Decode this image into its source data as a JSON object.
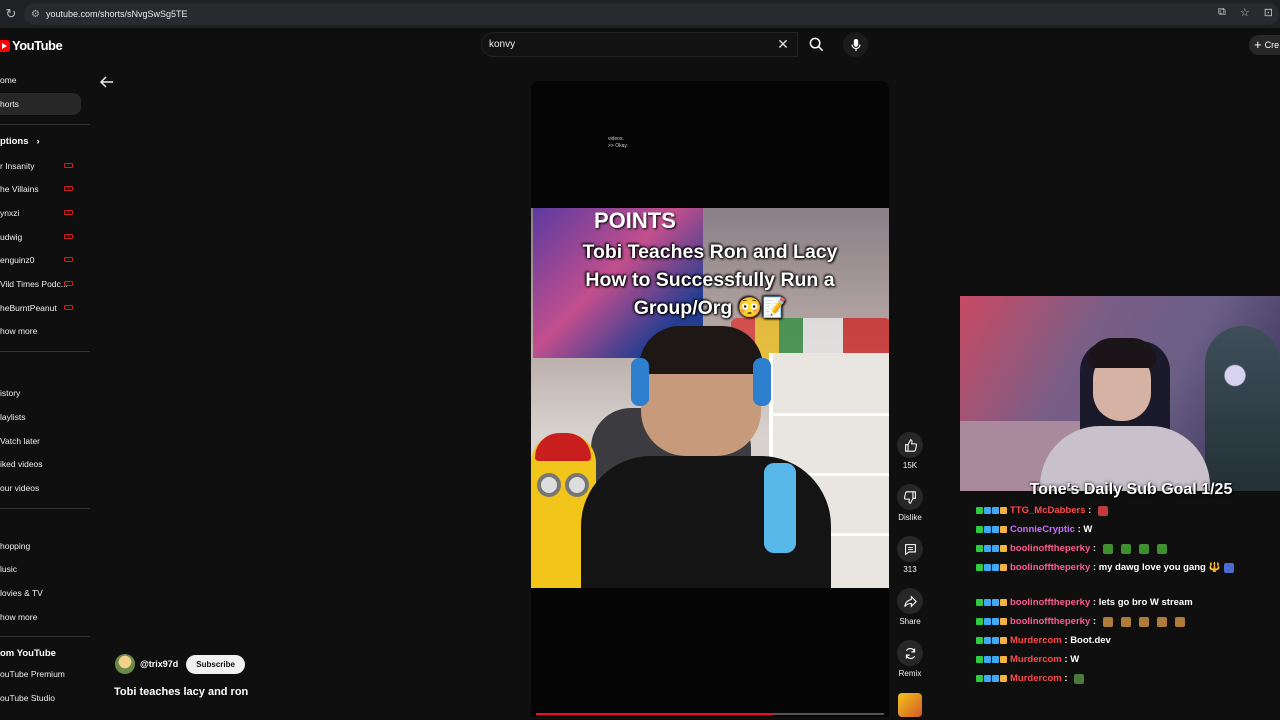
{
  "browser": {
    "url": "youtube.com/shorts/sNvgSwSg5TE"
  },
  "masthead": {
    "logo_text": "YouTube",
    "search_query": "konvy",
    "create_label": "Cre"
  },
  "sidebar": {
    "main": [
      {
        "label": "ome",
        "active": false
      },
      {
        "label": "horts",
        "active": true
      }
    ],
    "subscriptions_heading": "ptions",
    "subscriptions": [
      {
        "label": "r Insanity",
        "live": true
      },
      {
        "label": "he Villains",
        "live": true
      },
      {
        "label": "ynxzi",
        "live": true
      },
      {
        "label": "udwig",
        "live": true
      },
      {
        "label": "enguinz0",
        "live": true
      },
      {
        "label": "Vild Times Podc...",
        "live": true
      },
      {
        "label": "heBurntPeanut",
        "live": true
      },
      {
        "label": "how more",
        "live": false
      }
    ],
    "you_items": [
      "istory",
      "laylists",
      "Vatch later",
      "iked videos",
      "our videos"
    ],
    "explore_items": [
      "hopping",
      "lusic",
      "lovies & TV",
      "how more"
    ],
    "more_heading": "om YouTube",
    "more_items": [
      "ouTube Premium",
      "ouTube Studio"
    ]
  },
  "short": {
    "small_caption": "videos.\n>> Okay.",
    "overlay_top": "POINTS",
    "overlay_title": "Tobi Teaches Ron and Lacy\nHow to Successfully Run a\nGroup/Org 😳📝",
    "progress": 0.68,
    "channel": "@trix97d",
    "subscribe_label": "Subscribe",
    "title": "Tobi teaches lacy and ron"
  },
  "actions": {
    "like_count": "15K",
    "dislike_label": "Dislike",
    "comment_count": "313",
    "share_label": "Share",
    "remix_label": "Remix"
  },
  "stream": {
    "sub_goal": "Tone's Daily Sub Goal 1/25",
    "chat": [
      {
        "user": "TTG_McDabbers",
        "color": "#ff4a4a",
        "message": "",
        "emotes": 1
      },
      {
        "user": "ConnieCryptic",
        "color": "#c86eff",
        "message": "W",
        "emotes": 0
      },
      {
        "user": "boolinofftheperky",
        "color": "#ff5d8f",
        "message": "",
        "emotes": 4
      },
      {
        "user": "boolinofftheperky",
        "color": "#ff5d8f",
        "message": "my dawg love you gang 🔱",
        "emotes": 1
      },
      {
        "user": "boolinofftheperky",
        "color": "#ff5d8f",
        "message": "lets go bro W stream",
        "emotes": 0
      },
      {
        "user": "boolinofftheperky",
        "color": "#ff5d8f",
        "message": "",
        "emotes": 5
      },
      {
        "user": "Murdercom",
        "color": "#ff4a4a",
        "message": "Boot.dev",
        "emotes": 0
      },
      {
        "user": "Murdercom",
        "color": "#ff4a4a",
        "message": "W",
        "emotes": 0
      },
      {
        "user": "Murdercom",
        "color": "#ff4a4a",
        "message": "",
        "emotes": 1
      }
    ]
  },
  "colors": {
    "accent": "#ff0000",
    "progress": "#ff0033",
    "background": "#0f0f0f"
  }
}
